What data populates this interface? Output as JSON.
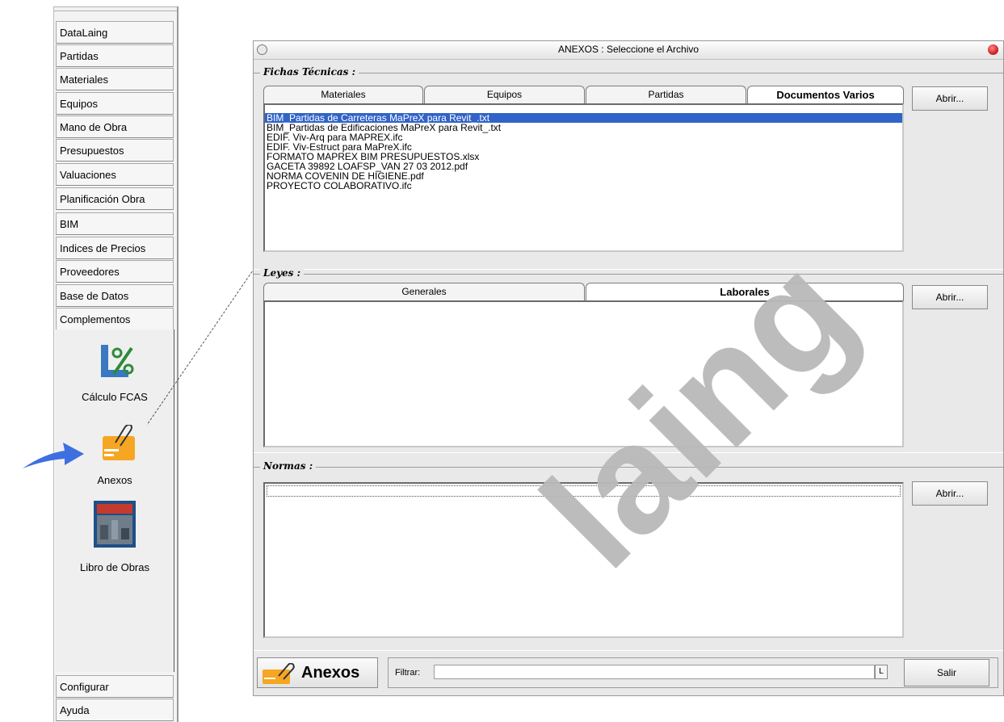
{
  "sidebar": {
    "items": [
      {
        "label": "DataLaing"
      },
      {
        "label": "Partidas"
      },
      {
        "label": "Materiales"
      },
      {
        "label": "Equipos"
      },
      {
        "label": "Mano de Obra"
      },
      {
        "label": "Presupuestos"
      },
      {
        "label": "Valuaciones"
      },
      {
        "label": "Planificación Obra"
      },
      {
        "label": "BIM"
      },
      {
        "label": "Indices de Precios"
      },
      {
        "label": "Proveedores"
      },
      {
        "label": "Base de Datos"
      },
      {
        "label": "Complementos"
      }
    ],
    "tools": [
      {
        "label": "Cálculo FCAS",
        "icon": "percent-icon"
      },
      {
        "label": "Anexos",
        "icon": "folder-clip-icon"
      },
      {
        "label": "Libro de Obras",
        "icon": "book-cover-icon"
      }
    ],
    "bottom": [
      {
        "label": "Configurar"
      },
      {
        "label": "Ayuda"
      }
    ]
  },
  "window": {
    "title": "ANEXOS : Seleccione el Archivo",
    "fichas": {
      "label": "Fichas Técnicas :",
      "tabs": [
        "Materiales",
        "Equipos",
        "Partidas",
        "Documentos Varios"
      ],
      "active_tab": "Documentos Varios",
      "button": "Abrir...",
      "files": [
        "BIM_Partidas de Carreteras MaPreX para Revit_.txt",
        "BIM_Partidas de Edificaciones MaPreX para Revit_.txt",
        "EDIF. Viv-Arq para MAPREX.ifc",
        "EDIF. Viv-Estruct para MaPreX.ifc",
        "FORMATO MAPREX BIM PRESUPUESTOS.xlsx",
        "GACETA 39892 LOAFSP_VAN 27 03 2012.pdf",
        "NORMA COVENIN DE HIGIENE.pdf",
        "PROYECTO COLABORATIVO.ifc"
      ],
      "selected_file": "BIM_Partidas de Carreteras MaPreX para Revit_.txt"
    },
    "leyes": {
      "label": "Leyes :",
      "tabs": [
        "Generales",
        "Laborales"
      ],
      "active_tab": "Laborales",
      "button": "Abrir..."
    },
    "normas": {
      "label": "Normas :",
      "button": "Abrir..."
    },
    "footer": {
      "anexos_label": "Anexos",
      "filter_label": "Filtrar:",
      "filter_value": "",
      "clear_button": "L",
      "exit_button": "Salir"
    }
  },
  "watermark": {
    "text": "laing",
    "color": "#b9b9b9"
  },
  "colors": {
    "selection": "#3163c8",
    "close": "#d42424",
    "arrow": "#3d6fe0",
    "folder": "#f6a623"
  }
}
